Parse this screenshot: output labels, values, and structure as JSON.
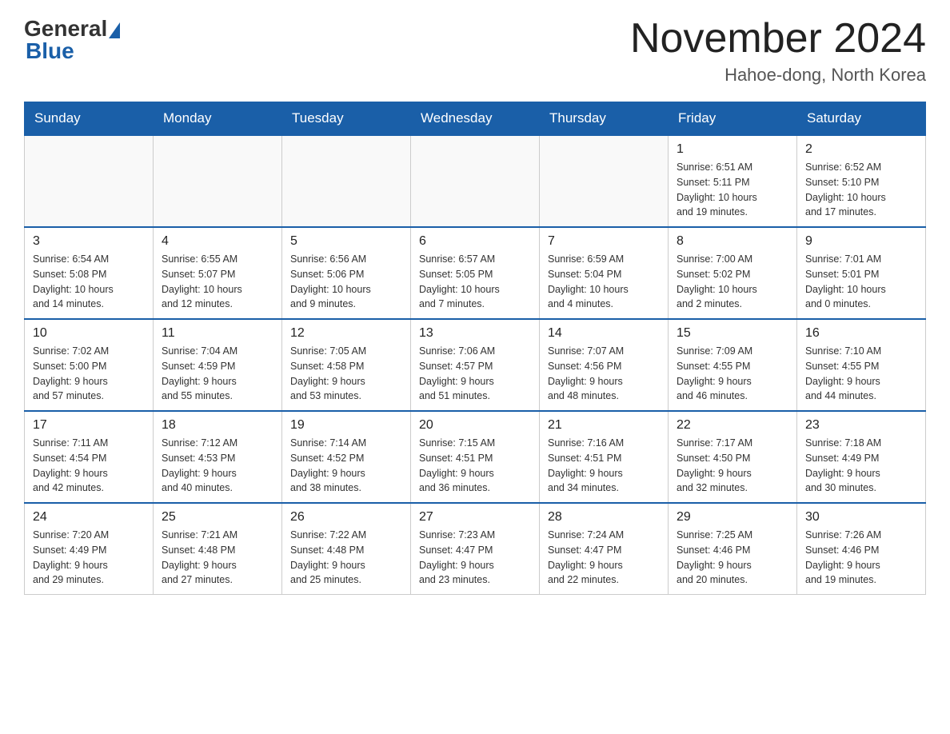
{
  "header": {
    "logo_text": "General",
    "logo_blue": "Blue",
    "month_title": "November 2024",
    "location": "Hahoe-dong, North Korea"
  },
  "days_of_week": [
    "Sunday",
    "Monday",
    "Tuesday",
    "Wednesday",
    "Thursday",
    "Friday",
    "Saturday"
  ],
  "weeks": [
    [
      {
        "day": "",
        "info": ""
      },
      {
        "day": "",
        "info": ""
      },
      {
        "day": "",
        "info": ""
      },
      {
        "day": "",
        "info": ""
      },
      {
        "day": "",
        "info": ""
      },
      {
        "day": "1",
        "info": "Sunrise: 6:51 AM\nSunset: 5:11 PM\nDaylight: 10 hours\nand 19 minutes."
      },
      {
        "day": "2",
        "info": "Sunrise: 6:52 AM\nSunset: 5:10 PM\nDaylight: 10 hours\nand 17 minutes."
      }
    ],
    [
      {
        "day": "3",
        "info": "Sunrise: 6:54 AM\nSunset: 5:08 PM\nDaylight: 10 hours\nand 14 minutes."
      },
      {
        "day": "4",
        "info": "Sunrise: 6:55 AM\nSunset: 5:07 PM\nDaylight: 10 hours\nand 12 minutes."
      },
      {
        "day": "5",
        "info": "Sunrise: 6:56 AM\nSunset: 5:06 PM\nDaylight: 10 hours\nand 9 minutes."
      },
      {
        "day": "6",
        "info": "Sunrise: 6:57 AM\nSunset: 5:05 PM\nDaylight: 10 hours\nand 7 minutes."
      },
      {
        "day": "7",
        "info": "Sunrise: 6:59 AM\nSunset: 5:04 PM\nDaylight: 10 hours\nand 4 minutes."
      },
      {
        "day": "8",
        "info": "Sunrise: 7:00 AM\nSunset: 5:02 PM\nDaylight: 10 hours\nand 2 minutes."
      },
      {
        "day": "9",
        "info": "Sunrise: 7:01 AM\nSunset: 5:01 PM\nDaylight: 10 hours\nand 0 minutes."
      }
    ],
    [
      {
        "day": "10",
        "info": "Sunrise: 7:02 AM\nSunset: 5:00 PM\nDaylight: 9 hours\nand 57 minutes."
      },
      {
        "day": "11",
        "info": "Sunrise: 7:04 AM\nSunset: 4:59 PM\nDaylight: 9 hours\nand 55 minutes."
      },
      {
        "day": "12",
        "info": "Sunrise: 7:05 AM\nSunset: 4:58 PM\nDaylight: 9 hours\nand 53 minutes."
      },
      {
        "day": "13",
        "info": "Sunrise: 7:06 AM\nSunset: 4:57 PM\nDaylight: 9 hours\nand 51 minutes."
      },
      {
        "day": "14",
        "info": "Sunrise: 7:07 AM\nSunset: 4:56 PM\nDaylight: 9 hours\nand 48 minutes."
      },
      {
        "day": "15",
        "info": "Sunrise: 7:09 AM\nSunset: 4:55 PM\nDaylight: 9 hours\nand 46 minutes."
      },
      {
        "day": "16",
        "info": "Sunrise: 7:10 AM\nSunset: 4:55 PM\nDaylight: 9 hours\nand 44 minutes."
      }
    ],
    [
      {
        "day": "17",
        "info": "Sunrise: 7:11 AM\nSunset: 4:54 PM\nDaylight: 9 hours\nand 42 minutes."
      },
      {
        "day": "18",
        "info": "Sunrise: 7:12 AM\nSunset: 4:53 PM\nDaylight: 9 hours\nand 40 minutes."
      },
      {
        "day": "19",
        "info": "Sunrise: 7:14 AM\nSunset: 4:52 PM\nDaylight: 9 hours\nand 38 minutes."
      },
      {
        "day": "20",
        "info": "Sunrise: 7:15 AM\nSunset: 4:51 PM\nDaylight: 9 hours\nand 36 minutes."
      },
      {
        "day": "21",
        "info": "Sunrise: 7:16 AM\nSunset: 4:51 PM\nDaylight: 9 hours\nand 34 minutes."
      },
      {
        "day": "22",
        "info": "Sunrise: 7:17 AM\nSunset: 4:50 PM\nDaylight: 9 hours\nand 32 minutes."
      },
      {
        "day": "23",
        "info": "Sunrise: 7:18 AM\nSunset: 4:49 PM\nDaylight: 9 hours\nand 30 minutes."
      }
    ],
    [
      {
        "day": "24",
        "info": "Sunrise: 7:20 AM\nSunset: 4:49 PM\nDaylight: 9 hours\nand 29 minutes."
      },
      {
        "day": "25",
        "info": "Sunrise: 7:21 AM\nSunset: 4:48 PM\nDaylight: 9 hours\nand 27 minutes."
      },
      {
        "day": "26",
        "info": "Sunrise: 7:22 AM\nSunset: 4:48 PM\nDaylight: 9 hours\nand 25 minutes."
      },
      {
        "day": "27",
        "info": "Sunrise: 7:23 AM\nSunset: 4:47 PM\nDaylight: 9 hours\nand 23 minutes."
      },
      {
        "day": "28",
        "info": "Sunrise: 7:24 AM\nSunset: 4:47 PM\nDaylight: 9 hours\nand 22 minutes."
      },
      {
        "day": "29",
        "info": "Sunrise: 7:25 AM\nSunset: 4:46 PM\nDaylight: 9 hours\nand 20 minutes."
      },
      {
        "day": "30",
        "info": "Sunrise: 7:26 AM\nSunset: 4:46 PM\nDaylight: 9 hours\nand 19 minutes."
      }
    ]
  ]
}
